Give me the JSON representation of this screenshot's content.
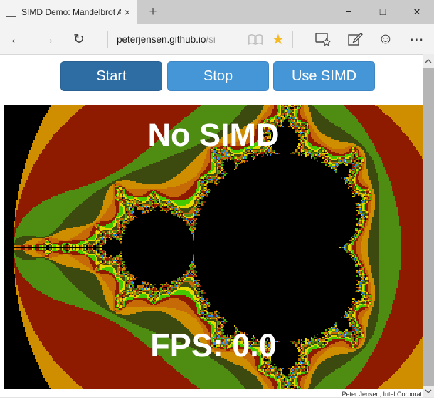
{
  "browser": {
    "tab": {
      "title": "SIMD Demo: Mandelbrot A",
      "close_glyph": "×",
      "favicon": "window-icon"
    },
    "new_tab_glyph": "+",
    "window_controls": {
      "minimize_glyph": "−",
      "maximize_glyph": "□",
      "close_glyph": "×"
    },
    "nav": {
      "back_glyph": "←",
      "forward_glyph": "→",
      "refresh_glyph": "↻",
      "url": "peterjensen.github.io",
      "url_tail": "/si",
      "star_glyph": "★",
      "smiley_glyph": "☺",
      "more_glyph": "⋯",
      "icons": [
        "reading-view-icon",
        "favorites-star-icon",
        "hub-icon",
        "web-note-icon",
        "feedback-smiley-icon",
        "more-icon"
      ]
    }
  },
  "page": {
    "buttons": [
      {
        "label": "Start",
        "active": true
      },
      {
        "label": "Stop",
        "active": false
      },
      {
        "label": "Use SIMD",
        "active": false
      }
    ],
    "overlay_top": "No SIMD",
    "overlay_bottom": "FPS: 0.0",
    "caption": "Peter Jensen, Intel Corporat",
    "colors": {
      "button_primary": "#4596d7",
      "button_active": "#2e6da4",
      "favorites_star": "#f5b922",
      "overlay_text": "#ffffff"
    },
    "fractal": {
      "re_min": -2.06,
      "re_max": 0.84,
      "im_min": -0.99,
      "im_max": 0.99,
      "max_iter": 100,
      "inside_color": "#000000",
      "palette": [
        "#000000",
        "#cf8d00",
        "#8e1b00",
        "#4f8c12",
        "#3c4a10",
        "#cf8d00",
        "#c66a08",
        "#8e1b00",
        "#45c800",
        "#e3d800",
        "#3c4a10",
        "#c66a08",
        "#4f8c12",
        "#e3d800",
        "#8e1b00",
        "#2f86e0"
      ]
    }
  }
}
